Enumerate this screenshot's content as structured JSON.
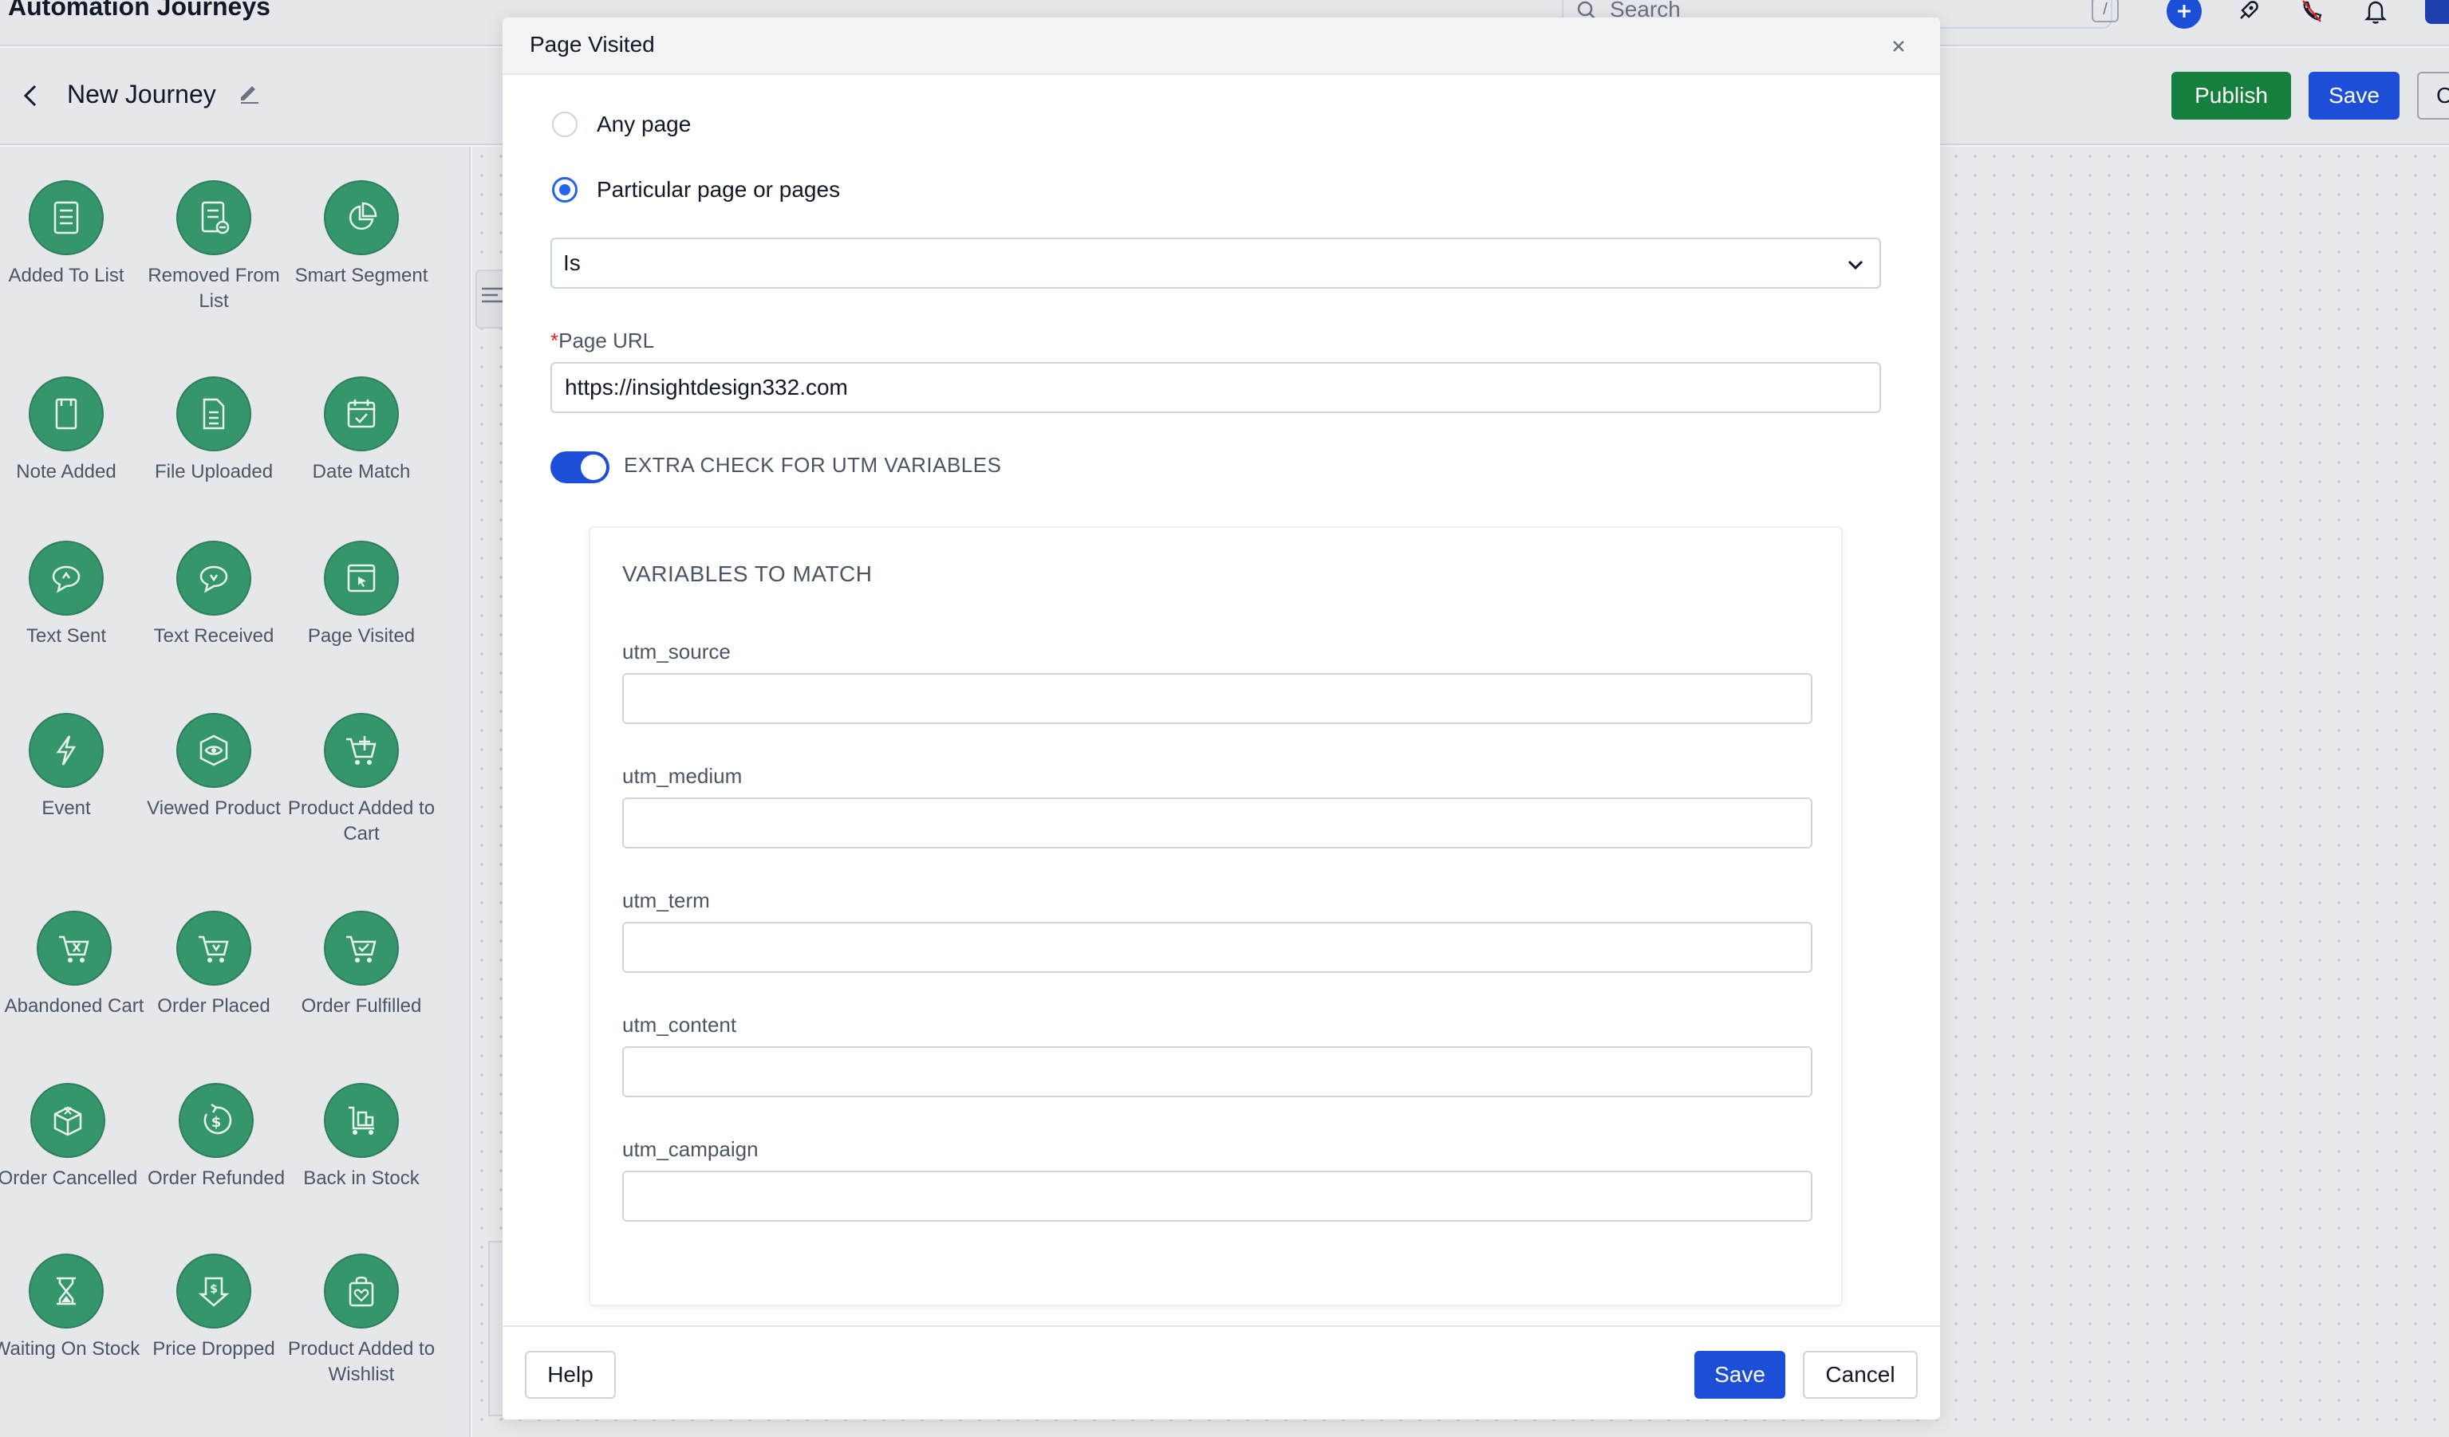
{
  "app": {
    "title": "Automation Journeys"
  },
  "search": {
    "placeholder": "Search",
    "shortcut": "/"
  },
  "topbar_icons": [
    "search-icon",
    "plus-icon",
    "rocket-icon",
    "phone-off-icon",
    "bell-icon",
    "avatar"
  ],
  "header": {
    "journey_name": "New Journey",
    "publish_label": "Publish",
    "save_label": "Save",
    "clipped_label": "C"
  },
  "palette": {
    "items": [
      {
        "label": "Added To List",
        "icon": "list-icon"
      },
      {
        "label": "Removed From List",
        "icon": "list-remove-icon"
      },
      {
        "label": "Smart Segment",
        "icon": "pie-chart-icon"
      },
      {
        "label": "Note Added",
        "icon": "note-icon"
      },
      {
        "label": "File Uploaded",
        "icon": "file-icon"
      },
      {
        "label": "Date Match",
        "icon": "calendar-check-icon"
      },
      {
        "label": "Text Sent",
        "icon": "chat-out-icon"
      },
      {
        "label": "Text Received",
        "icon": "chat-in-icon"
      },
      {
        "label": "Page Visited",
        "icon": "page-click-icon"
      },
      {
        "label": "Event",
        "icon": "lightning-icon"
      },
      {
        "label": "Viewed Product",
        "icon": "eye-box-icon"
      },
      {
        "label": "Product Added to Cart",
        "icon": "cart-plus-icon"
      },
      {
        "label": "Abandoned Cart",
        "icon": "cart-x-icon"
      },
      {
        "label": "Order Placed",
        "icon": "cart-down-icon"
      },
      {
        "label": "Order Fulfilled",
        "icon": "cart-check-icon"
      },
      {
        "label": "Order Cancelled",
        "icon": "box-x-icon"
      },
      {
        "label": "Order Refunded",
        "icon": "dollar-refund-icon"
      },
      {
        "label": "Back in Stock",
        "icon": "dolly-icon"
      },
      {
        "label": "Waiting On Stock",
        "icon": "hourglass-icon"
      },
      {
        "label": "Price Dropped",
        "icon": "price-down-icon"
      },
      {
        "label": "Product Added to Wishlist",
        "icon": "bag-heart-icon"
      }
    ]
  },
  "modal": {
    "title": "Page Visited",
    "radio_any": "Any page",
    "radio_particular": "Particular page or pages",
    "selected_radio": "Particular page or pages",
    "condition_select": "Is",
    "page_url_label": "Page URL",
    "page_url_required_mark": "*",
    "page_url_value": "https://insightdesign332.com",
    "toggle_label": "EXTRA CHECK FOR UTM VARIABLES",
    "toggle_on": true,
    "utm": {
      "heading": "VARIABLES TO MATCH",
      "fields": [
        {
          "label": "utm_source",
          "value": ""
        },
        {
          "label": "utm_medium",
          "value": ""
        },
        {
          "label": "utm_term",
          "value": ""
        },
        {
          "label": "utm_content",
          "value": ""
        },
        {
          "label": "utm_campaign",
          "value": ""
        }
      ]
    },
    "footer": {
      "help_label": "Help",
      "save_label": "Save",
      "cancel_label": "Cancel"
    }
  },
  "colors": {
    "primary": "#1d4ed8",
    "success": "#15803d",
    "trigger_green": "#35956b",
    "required": "#dc2626"
  }
}
